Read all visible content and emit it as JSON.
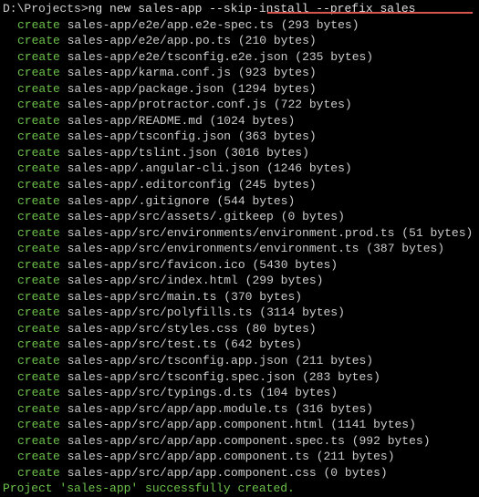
{
  "prompt": {
    "path": "D:\\Projects>",
    "command": "ng new sales-app --skip-install --prefix sales"
  },
  "keyword": "create",
  "lines": [
    {
      "file": "sales-app/e2e/app.e2e-spec.ts",
      "size": "(293 bytes)"
    },
    {
      "file": "sales-app/e2e/app.po.ts",
      "size": "(210 bytes)"
    },
    {
      "file": "sales-app/e2e/tsconfig.e2e.json",
      "size": "(235 bytes)"
    },
    {
      "file": "sales-app/karma.conf.js",
      "size": "(923 bytes)"
    },
    {
      "file": "sales-app/package.json",
      "size": "(1294 bytes)"
    },
    {
      "file": "sales-app/protractor.conf.js",
      "size": "(722 bytes)"
    },
    {
      "file": "sales-app/README.md",
      "size": "(1024 bytes)"
    },
    {
      "file": "sales-app/tsconfig.json",
      "size": "(363 bytes)"
    },
    {
      "file": "sales-app/tslint.json",
      "size": "(3016 bytes)"
    },
    {
      "file": "sales-app/.angular-cli.json",
      "size": "(1246 bytes)"
    },
    {
      "file": "sales-app/.editorconfig",
      "size": "(245 bytes)"
    },
    {
      "file": "sales-app/.gitignore",
      "size": "(544 bytes)"
    },
    {
      "file": "sales-app/src/assets/.gitkeep",
      "size": "(0 bytes)"
    },
    {
      "file": "sales-app/src/environments/environment.prod.ts",
      "size": "(51 bytes)"
    },
    {
      "file": "sales-app/src/environments/environment.ts",
      "size": "(387 bytes)"
    },
    {
      "file": "sales-app/src/favicon.ico",
      "size": "(5430 bytes)"
    },
    {
      "file": "sales-app/src/index.html",
      "size": "(299 bytes)"
    },
    {
      "file": "sales-app/src/main.ts",
      "size": "(370 bytes)"
    },
    {
      "file": "sales-app/src/polyfills.ts",
      "size": "(3114 bytes)"
    },
    {
      "file": "sales-app/src/styles.css",
      "size": "(80 bytes)"
    },
    {
      "file": "sales-app/src/test.ts",
      "size": "(642 bytes)"
    },
    {
      "file": "sales-app/src/tsconfig.app.json",
      "size": "(211 bytes)"
    },
    {
      "file": "sales-app/src/tsconfig.spec.json",
      "size": "(283 bytes)"
    },
    {
      "file": "sales-app/src/typings.d.ts",
      "size": "(104 bytes)"
    },
    {
      "file": "sales-app/src/app/app.module.ts",
      "size": "(316 bytes)"
    },
    {
      "file": "sales-app/src/app/app.component.html",
      "size": "(1141 bytes)"
    },
    {
      "file": "sales-app/src/app/app.component.spec.ts",
      "size": "(992 bytes)"
    },
    {
      "file": "sales-app/src/app/app.component.ts",
      "size": "(211 bytes)"
    },
    {
      "file": "sales-app/src/app/app.component.css",
      "size": "(0 bytes)"
    }
  ],
  "success": "Project 'sales-app' successfully created."
}
